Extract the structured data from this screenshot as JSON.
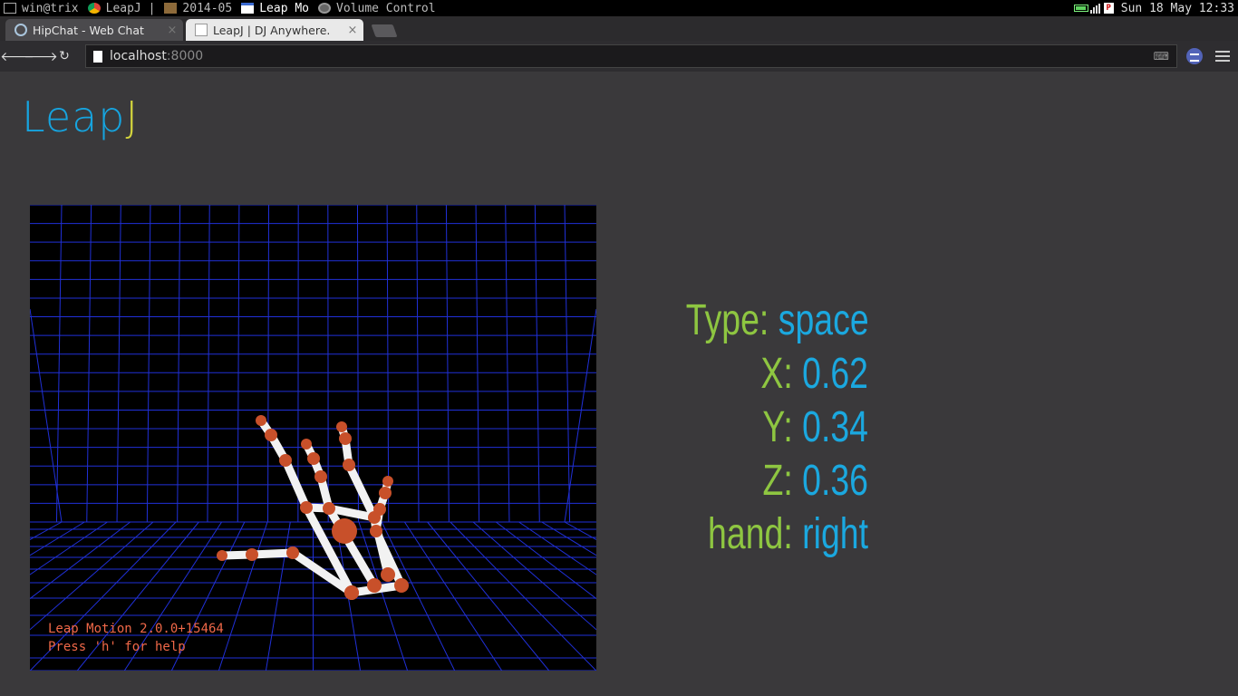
{
  "taskbar": {
    "items": [
      {
        "label": "win@trix",
        "icon": "terminal-icon"
      },
      {
        "label": "LeapJ |",
        "icon": "chrome-icon"
      },
      {
        "label": "2014-05",
        "icon": "folder-icon"
      },
      {
        "label": "Leap Mo",
        "icon": "window-icon"
      },
      {
        "label": "Volume Control",
        "icon": "speaker-icon"
      }
    ],
    "clock": "Sun 18 May 12:33"
  },
  "browser": {
    "tabs": [
      {
        "label": "HipChat - Web Chat",
        "close": "×",
        "active": false
      },
      {
        "label": "LeapJ | DJ Anywhere.",
        "close": "×",
        "active": true
      }
    ],
    "url_host": "localhost",
    "url_port": ":8000",
    "nav": {
      "back": "🡐",
      "forward": "🡒",
      "reload": "↻"
    }
  },
  "app": {
    "logo_main": "Leap",
    "logo_accent": "J",
    "visualizer": {
      "version_text": "Leap Motion 2.0.0+15464",
      "help_text": "Press 'h' for help",
      "grid_color": "#2030d8",
      "joint_color": "#c8502a",
      "bone_color": "#f2f2f2"
    },
    "readout": {
      "type_label": "Type:",
      "type_value": "space",
      "x_label": "X:",
      "x_value": "0.62",
      "y_label": "Y:",
      "y_value": "0.34",
      "z_label": "Z:",
      "z_value": "0.36",
      "hand_label": "hand:",
      "hand_value": "right"
    },
    "colors": {
      "label": "#8ec641",
      "value": "#1ba8df",
      "background": "#3a393b"
    }
  }
}
